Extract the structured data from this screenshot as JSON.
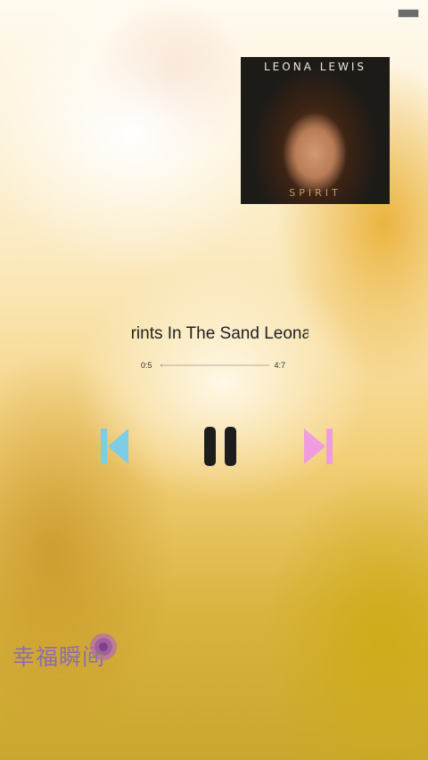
{
  "album": {
    "artist": "LEONA LEWIS",
    "title": "SPIRIT"
  },
  "song": {
    "marquee_text": "Footprints In The Sand   Leona Lewis"
  },
  "playback": {
    "elapsed": "0:5",
    "total": "4:7",
    "progress_fraction": 0.02
  },
  "controls": {
    "prev_icon": "skip-previous-icon",
    "pause_icon": "pause-icon",
    "next_icon": "skip-next-icon"
  },
  "branding": {
    "logo_text": "幸福瞬间"
  },
  "colors": {
    "prev_icon": "#7ecde6",
    "pause_icon": "#1d1d1d",
    "next_icon": "#ef9ddf",
    "progress_fill": "#b39bbf",
    "logo": "#8b6db1"
  }
}
